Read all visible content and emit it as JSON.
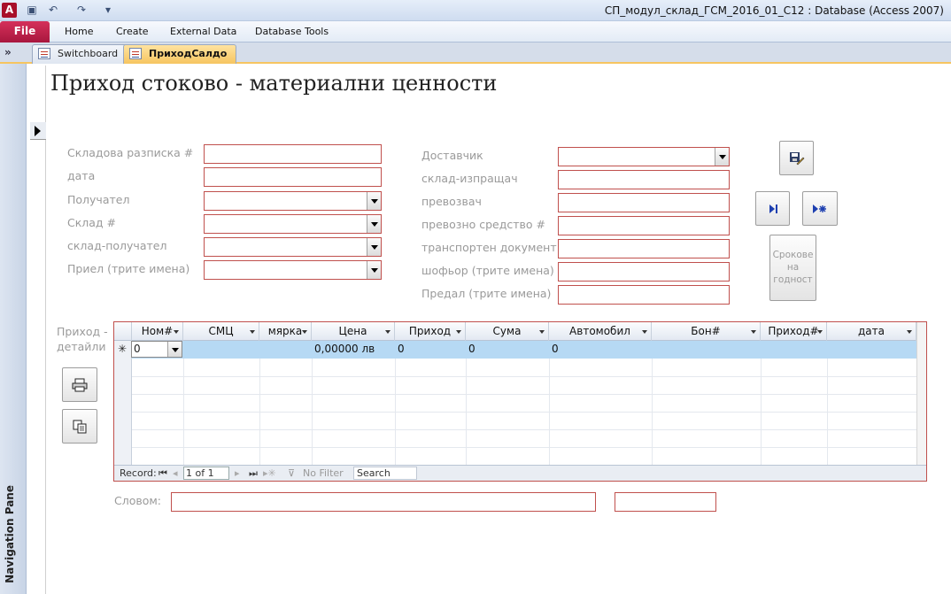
{
  "app": {
    "window_title": "СП_модул_склад_ГСМ_2016_01_С12 : Database (Access 2007)",
    "logo_letter": "A"
  },
  "ribbon": {
    "file": "File",
    "tabs": [
      "Home",
      "Create",
      "External Data",
      "Database Tools"
    ]
  },
  "doc_tabs": [
    "Switchboard",
    "ПриходСалдо"
  ],
  "nav_pane": {
    "label": "Navigation Pane",
    "toggle": "»"
  },
  "form": {
    "title": "Приход стоково - материални ценности",
    "left_fields": [
      {
        "label": "Складова разписка #",
        "type": "text",
        "value": ""
      },
      {
        "label": "дата",
        "type": "text",
        "value": ""
      },
      {
        "label": "Получател",
        "type": "combo",
        "value": ""
      },
      {
        "label": "Склад #",
        "type": "combo",
        "value": ""
      },
      {
        "label": "склад-получател",
        "type": "combo",
        "value": ""
      },
      {
        "label": "Приел (трите имена)",
        "type": "combo",
        "value": ""
      }
    ],
    "right_fields": [
      {
        "label": "Доставчик",
        "type": "combo",
        "value": ""
      },
      {
        "label": "склад-изпращач",
        "type": "text",
        "value": ""
      },
      {
        "label": "превозвач",
        "type": "text",
        "value": ""
      },
      {
        "label": "превозно средство #",
        "type": "text",
        "value": ""
      },
      {
        "label": "транспортен документ",
        "type": "text",
        "value": ""
      },
      {
        "label": "шофьор (трите имена)",
        "type": "text",
        "value": ""
      },
      {
        "label": "Предал (трите имена)",
        "type": "text",
        "value": ""
      }
    ],
    "buttons": {
      "save_icon": "save-edit-icon",
      "next_icon": "next-record-icon",
      "new_icon": "new-record-icon",
      "expiry_label": "Срокове на годност",
      "print_icon": "print-icon",
      "copy_icon": "copy-icon"
    },
    "subform_label": "Приход - детайли",
    "words_label": "Словом:",
    "words_value": "",
    "words_extra_value": ""
  },
  "subform": {
    "columns": [
      "Ном#",
      "СМЦ",
      "мярка",
      "Цена",
      "Приход",
      "Сума",
      "Автомобил",
      "Бон#",
      "Приход#",
      "дата"
    ],
    "new_row": [
      "0",
      "",
      "",
      "0,00000 лв",
      "0",
      "0",
      "0",
      "",
      "",
      ""
    ],
    "new_row_marker": "✳",
    "nav": {
      "record_label": "Record:",
      "position": "1 of 1",
      "filter": "No Filter",
      "search": "Search"
    }
  },
  "colors": {
    "accent_border": "#c0504d",
    "selected_row": "#b6d9f4",
    "active_tab": "#f6c560"
  }
}
